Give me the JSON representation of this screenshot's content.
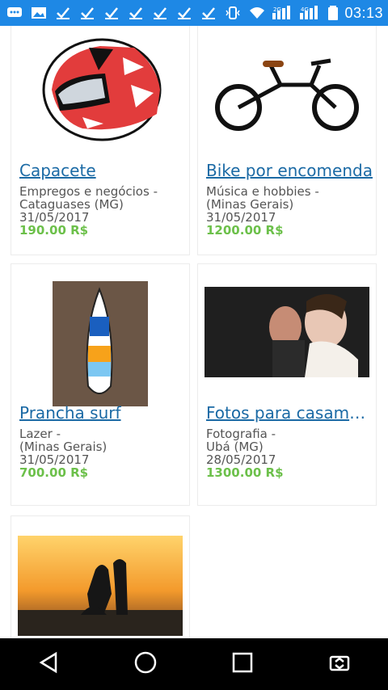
{
  "status_bar": {
    "time": "03:13",
    "icons": [
      "chat-icon",
      "image-icon",
      "check-icon",
      "check-icon",
      "check-icon",
      "check-icon",
      "check-icon",
      "check-icon",
      "check-icon",
      "vibrate-icon",
      "wifi-icon",
      "signal-2g-icon",
      "signal-4g-icon",
      "battery-icon"
    ],
    "network_1": "2G",
    "network_2": "4G"
  },
  "listings": [
    {
      "title": "Capacete",
      "category": "Empregos e negócios -",
      "location": "Cataguases (MG)",
      "date": "31/05/2017",
      "price": "190.00 R$"
    },
    {
      "title": "Bike por encomenda",
      "category": "Música e hobbies -",
      "location": "(Minas Gerais)",
      "date": "31/05/2017",
      "price": "1200.00 R$"
    },
    {
      "title": "Prancha surf",
      "category": "Lazer -",
      "location": "(Minas Gerais)",
      "date": "31/05/2017",
      "price": "700.00 R$"
    },
    {
      "title": "Fotos para casamen…",
      "category": "Fotografia -",
      "location": "Ubá (MG)",
      "date": "28/05/2017",
      "price": "1300.00 R$"
    }
  ],
  "colors": {
    "status_bar": "#1e88e5",
    "title_link": "#1b6aa5",
    "price": "#6cc04a",
    "nav_bar": "#000000"
  },
  "nav": {
    "buttons": [
      "back-icon",
      "home-icon",
      "recents-icon",
      "screen-rotate-icon"
    ]
  }
}
